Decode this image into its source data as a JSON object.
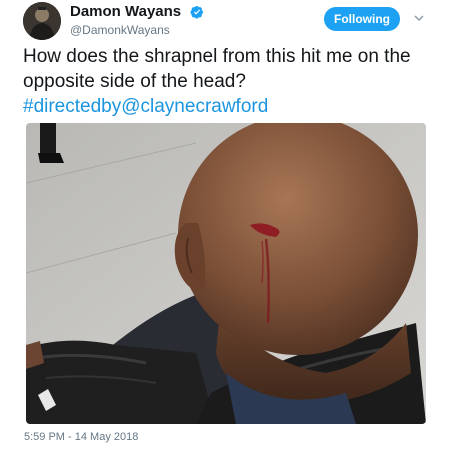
{
  "author": {
    "display_name": "Damon Wayans",
    "handle": "@DamonkWayans",
    "verified": true,
    "avatar_icon": "profile-avatar"
  },
  "follow_button": {
    "label": "Following",
    "color": "#1da1f2"
  },
  "menu": {
    "icon": "chevron-down-icon"
  },
  "tweet": {
    "text_main": "How does the shrapnel from this hit me on the opposite side of the head?",
    "hashtag": "#directedby",
    "mention": "@claynecrawford",
    "link_color": "#1b95e0"
  },
  "media": {
    "type": "photo"
  },
  "timestamp": "5:59 PM - 14 May 2018"
}
